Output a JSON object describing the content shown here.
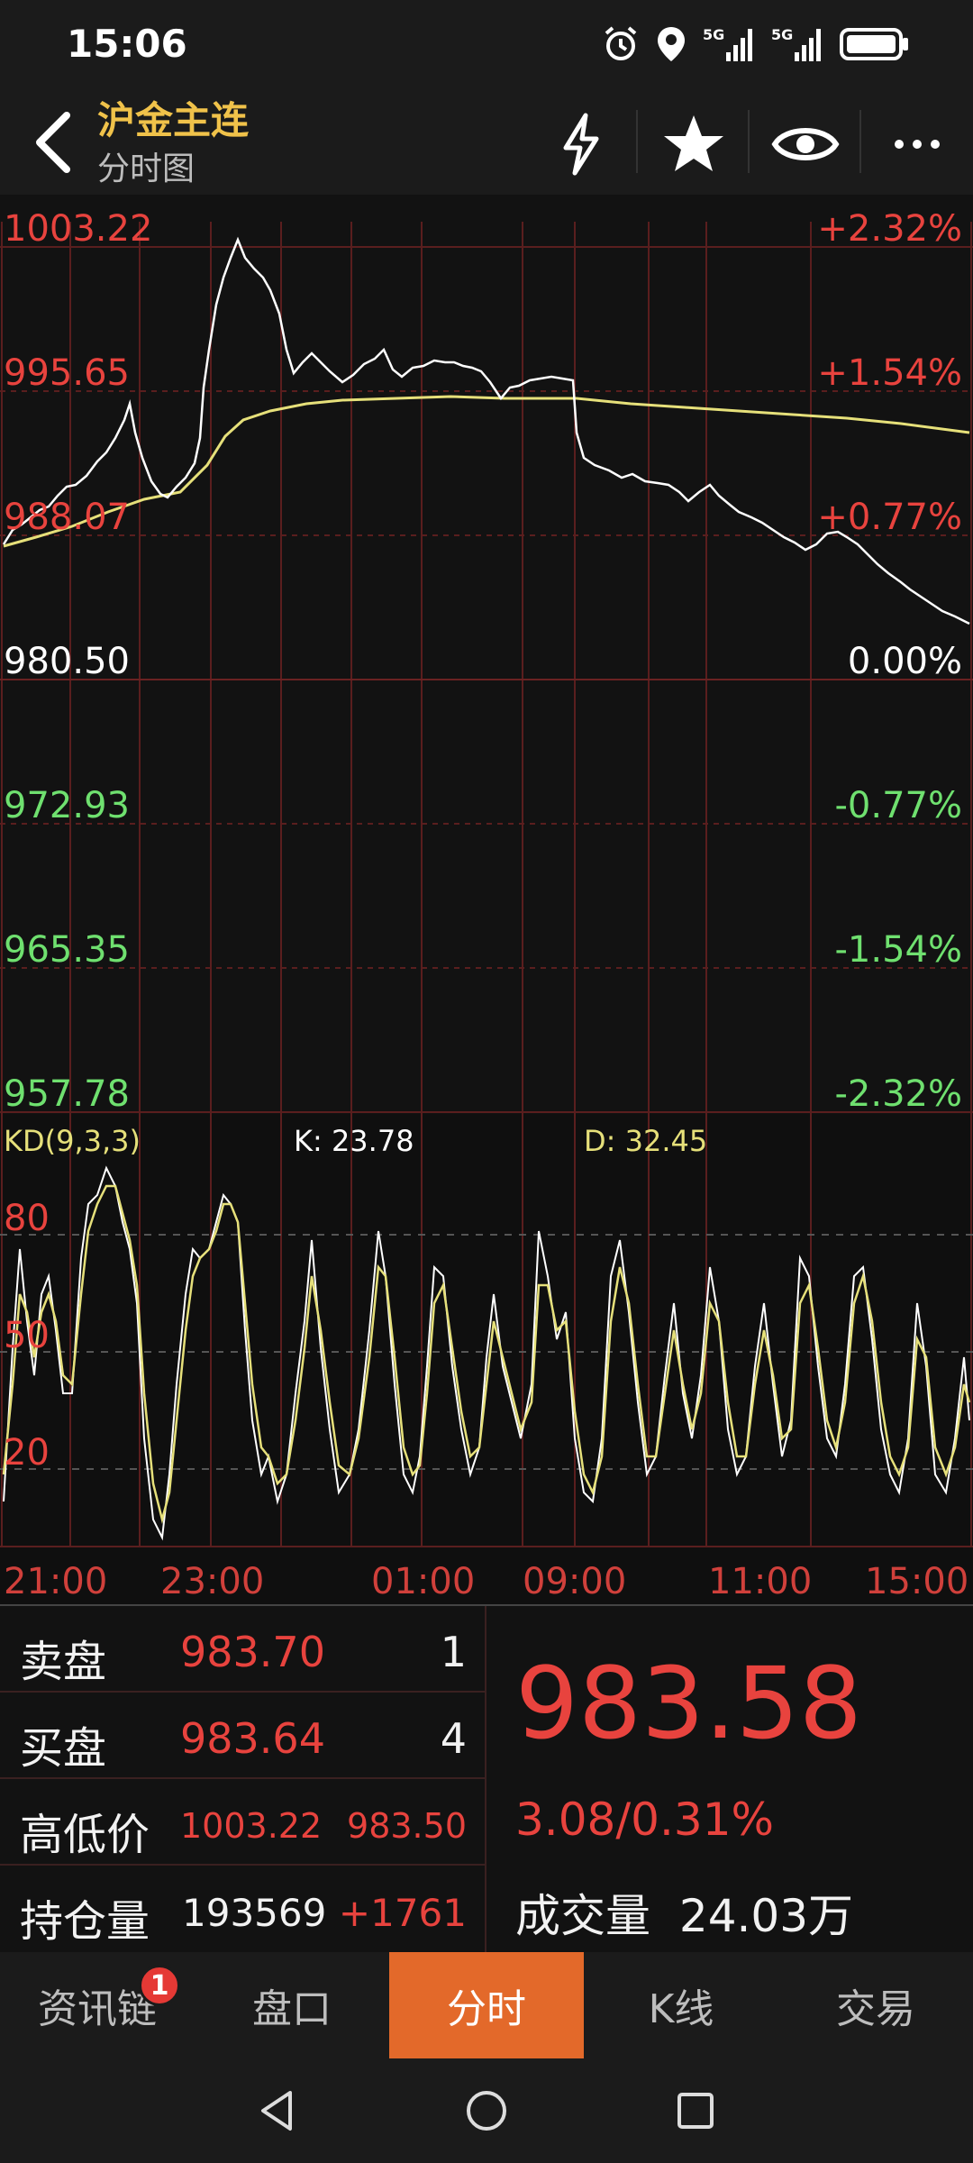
{
  "status_bar": {
    "time": "15:06",
    "icons": [
      "alarm-icon",
      "location-icon",
      "5g-signal-icon",
      "5g-signal-icon",
      "battery-icon"
    ],
    "signal_1": "5G",
    "signal_2": "5G"
  },
  "header": {
    "title": "沪金主连",
    "subtitle": "分时图",
    "icons": [
      "lightning-icon",
      "star-icon",
      "eye-icon",
      "more-icon"
    ]
  },
  "price_chart": {
    "left_labels": [
      "1003.22",
      "995.65",
      "988.07",
      "980.50",
      "972.93",
      "965.35",
      "957.78"
    ],
    "right_labels": [
      "+2.32%",
      "+1.54%",
      "+0.77%",
      "0.00%",
      "-0.77%",
      "-1.54%",
      "-2.32%"
    ],
    "colors": {
      "up": "#e8433e",
      "neutral": "#ffffff",
      "down": "#6fe06f",
      "price_line": "#ffffff",
      "avg_line": "#e6e07a"
    }
  },
  "kd_indicator": {
    "name": "KD(9,3,3)",
    "k_label": "K: 23.78",
    "d_label": "D: 32.45",
    "levels": [
      "80",
      "50",
      "20"
    ]
  },
  "time_axis": [
    "21:00",
    "23:00",
    "01:00",
    "09:00",
    "11:00",
    "15:00"
  ],
  "info": {
    "sell_label": "卖盘",
    "sell_price": "983.70",
    "sell_qty": "1",
    "buy_label": "买盘",
    "buy_price": "983.64",
    "buy_qty": "4",
    "hilo_label": "高低价",
    "high": "1003.22",
    "low": "983.50",
    "oi_label": "持仓量",
    "open_interest": "193569",
    "oi_change": "+1761",
    "last_price": "983.58",
    "change": "3.08/0.31%",
    "volume_label": "成交量",
    "volume": "24.03万"
  },
  "tabs": [
    {
      "label": "资讯链",
      "badge": "1"
    },
    {
      "label": "盘口"
    },
    {
      "label": "分时",
      "active": true
    },
    {
      "label": "K线"
    },
    {
      "label": "交易"
    }
  ],
  "nav": [
    "back-nav-icon",
    "home-nav-icon",
    "recents-nav-icon"
  ]
}
